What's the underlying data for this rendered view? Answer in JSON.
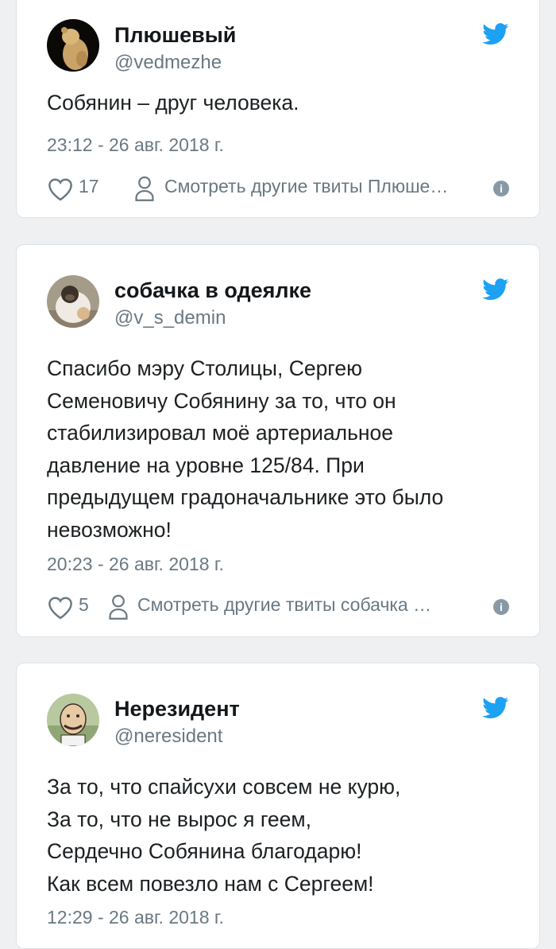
{
  "tweets": [
    {
      "name": "Плюшевый",
      "handle": "@vedmezhe",
      "avatar_icon": "plush-bear-avatar",
      "text_lines": [
        "Собянин – друг человека."
      ],
      "time": "23:12 - 26 авг. 2018 г.",
      "likes": "17",
      "more_label": "Смотреть другие твиты Плюше…"
    },
    {
      "name": "собачка в одеялке",
      "handle": "@v_s_demin",
      "avatar_icon": "dog-in-blanket-avatar",
      "text_lines": [
        "Спасибо мэру Столицы, Сергею",
        "Семеновичу Собянину за то, что он",
        "стабилизировал моё артериальное",
        "давление на уровне 125/84. При",
        "предыдущем градоначальнике это было",
        "невозможно!"
      ],
      "time": "20:23 - 26 авг. 2018 г.",
      "likes": "5",
      "more_label": "Смотреть другие твиты собачка …"
    },
    {
      "name": "Нерезидент",
      "handle": "@neresident",
      "avatar_icon": "cartoon-man-avatar",
      "text_lines": [
        "За то, что спайсухи совсем не курю,",
        "За то, что не вырос я геем,",
        "Сердечно Собянина благодарю!",
        "Как всем повезло нам с Сергеем!"
      ],
      "time": "12:29 - 26 авг. 2018 г."
    }
  ],
  "colors": {
    "background": "#eef0f2",
    "card": "#ffffff",
    "twitter_blue": "#1da1f2",
    "secondary_text": "#697882"
  }
}
